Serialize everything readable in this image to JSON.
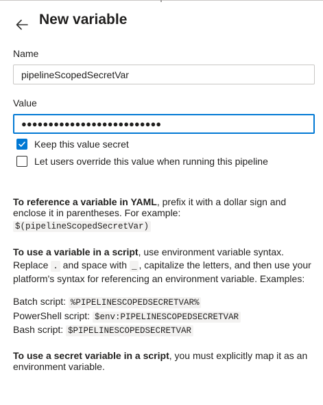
{
  "panel": {
    "title": "New variable"
  },
  "name_field": {
    "label": "Name",
    "value": "pipelineScopedSecretVar"
  },
  "value_field": {
    "label": "Value",
    "value": "●●●●●●●●●●●●●●●●●●●●●●●●●●"
  },
  "checkboxes": [
    {
      "label": "Keep this value secret",
      "checked": true
    },
    {
      "label": "Let users override this value when running this pipeline",
      "checked": false
    }
  ],
  "yaml_help": {
    "bold": "To reference a variable in YAML",
    "text": ", prefix it with a dollar sign and enclose it in parentheses. For example:",
    "code": "$(pipelineScopedSecretVar)"
  },
  "script_help": {
    "bold": "To use a variable in a script",
    "text1": ", use environment variable syntax. Replace ",
    "code1": ".",
    "text2": " and space with ",
    "code2": "_",
    "text3": ", capitalize the letters, and then use your platform's syntax for referencing an environment variable. Examples:"
  },
  "examples": [
    {
      "label": "Batch script:",
      "code": "%PIPELINESCOPEDSECRETVAR%"
    },
    {
      "label": "PowerShell script:",
      "code": "$env:PIPELINESCOPEDSECRETVAR"
    },
    {
      "label": "Bash script:",
      "code": "$PIPELINESCOPEDSECRETVAR"
    }
  ],
  "secret_help": {
    "bold": "To use a secret variable in a script",
    "text": ", you must explicitly map it as an environment variable."
  },
  "colors": {
    "accent": "#0078d4",
    "text": "#201f1e",
    "border": "#c8c6c4",
    "code_bg": "#f3f2f1"
  }
}
